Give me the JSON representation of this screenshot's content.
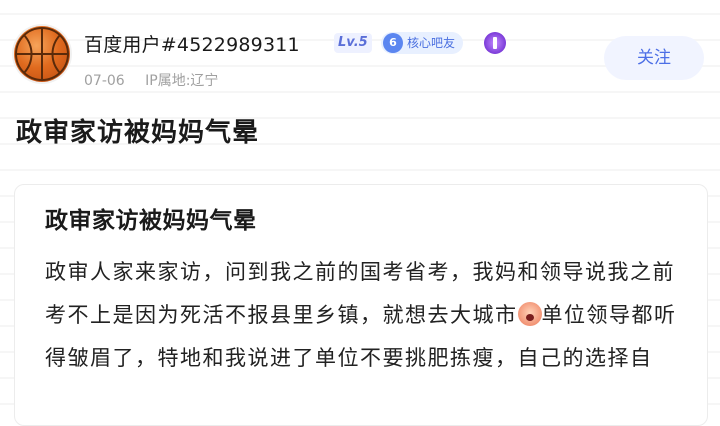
{
  "post": {
    "username": "百度用户#4522989311",
    "level": "Lv.5",
    "core_badge_number": "6",
    "core_badge_label": "核心吧友",
    "date": "07-06",
    "ip_location": "IP属地:辽宁",
    "follow_label": "关注",
    "title": "政审家访被妈妈气晕"
  },
  "card": {
    "title": "政审家访被妈妈气晕",
    "body_part1": "政审人家来家访，问到我之前的国考省考，我妈和领导说我之前考不上是因为死活不报县里乡镇，就想去大城市",
    "emoji_icon": "angry-face-icon",
    "body_part2": "单位领导都听得皱眉了，特地和我说进了单位不要挑肥拣瘦，自己的选择自"
  },
  "colors": {
    "accent": "#4d6fe6",
    "follow_bg": "#f1f4ff",
    "meta_text": "#a0a0a0"
  }
}
